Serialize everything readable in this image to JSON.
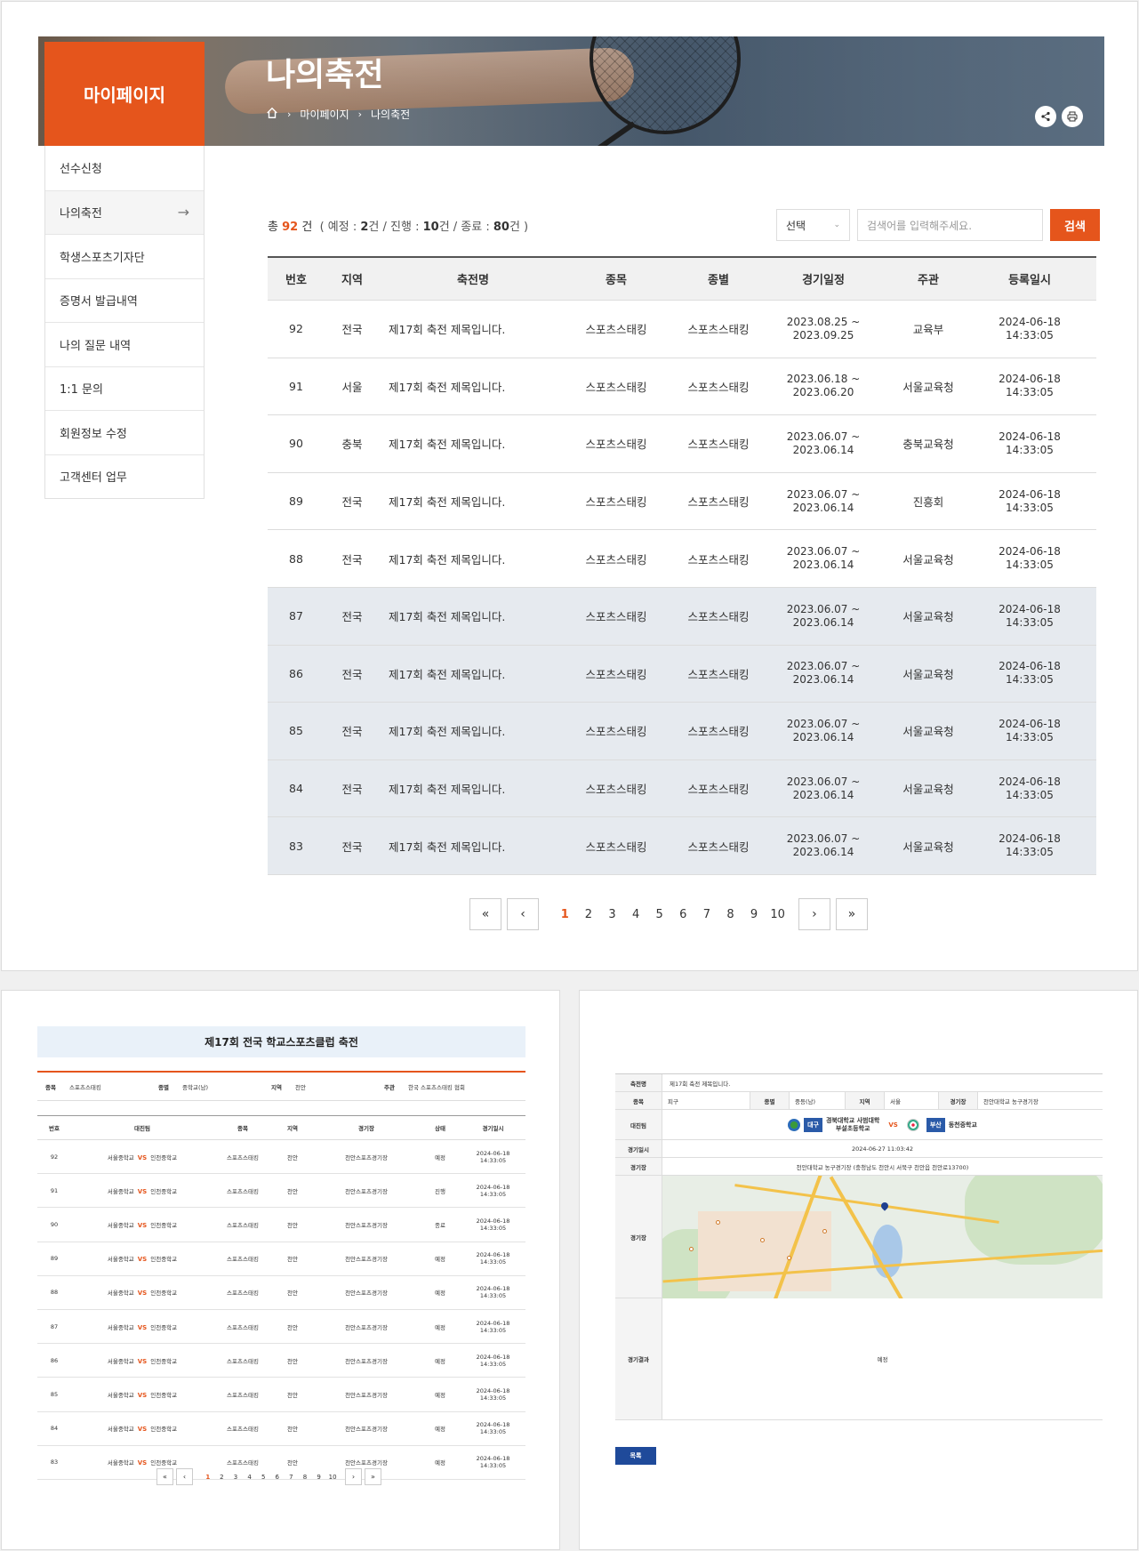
{
  "hero": {
    "title": "나의축전",
    "breadcrumb": [
      "마이페이지",
      "나의축전"
    ],
    "sidebar_title": "마이페이지"
  },
  "sidebar": {
    "items": [
      {
        "label": "선수신청"
      },
      {
        "label": "나의축전",
        "active": true
      },
      {
        "label": "학생스포츠기자단"
      },
      {
        "label": "증명서 발급내역"
      },
      {
        "label": "나의 질문 내역"
      },
      {
        "label": "1:1 문의"
      },
      {
        "label": "회원정보 수정"
      },
      {
        "label": "고객센터 업무"
      }
    ]
  },
  "summary": {
    "prefix": "총",
    "total": "92",
    "unit": "건",
    "detail_open": "( 예정 :",
    "scheduled": "2",
    "sep1": "건 / 진행 :",
    "ongoing": "10",
    "sep2": "건 / 종료 :",
    "ended": "80",
    "detail_close": "건 )"
  },
  "search": {
    "select_label": "선택",
    "placeholder": "검색어를 입력해주세요.",
    "button": "검색"
  },
  "table": {
    "headers": [
      "번호",
      "지역",
      "축전명",
      "종목",
      "종별",
      "경기일정",
      "주관",
      "등록일시"
    ],
    "rows": [
      {
        "no": "92",
        "region": "전국",
        "name": "제17회 축전 제목입니다.",
        "sport": "스포츠스태킹",
        "category": "스포츠스태킹",
        "date1": "2023.08.25 ~",
        "date2": "2023.09.25",
        "host": "교육부",
        "reg1": "2024-06-18",
        "reg2": "14:33:05"
      },
      {
        "no": "91",
        "region": "서울",
        "name": "제17회 축전 제목입니다.",
        "sport": "스포츠스태킹",
        "category": "스포츠스태킹",
        "date1": "2023.06.18 ~",
        "date2": "2023.06.20",
        "host": "서울교육청",
        "reg1": "2024-06-18",
        "reg2": "14:33:05"
      },
      {
        "no": "90",
        "region": "충북",
        "name": "제17회 축전 제목입니다.",
        "sport": "스포츠스태킹",
        "category": "스포츠스태킹",
        "date1": "2023.06.07 ~",
        "date2": "2023.06.14",
        "host": "충북교육청",
        "reg1": "2024-06-18",
        "reg2": "14:33:05"
      },
      {
        "no": "89",
        "region": "전국",
        "name": "제17회 축전 제목입니다.",
        "sport": "스포츠스태킹",
        "category": "스포츠스태킹",
        "date1": "2023.06.07 ~",
        "date2": "2023.06.14",
        "host": "진흥회",
        "reg1": "2024-06-18",
        "reg2": "14:33:05"
      },
      {
        "no": "88",
        "region": "전국",
        "name": "제17회 축전 제목입니다.",
        "sport": "스포츠스태킹",
        "category": "스포츠스태킹",
        "date1": "2023.06.07 ~",
        "date2": "2023.06.14",
        "host": "서울교육청",
        "reg1": "2024-06-18",
        "reg2": "14:33:05"
      },
      {
        "no": "87",
        "region": "전국",
        "name": "제17회 축전 제목입니다.",
        "sport": "스포츠스태킹",
        "category": "스포츠스태킹",
        "date1": "2023.06.07 ~",
        "date2": "2023.06.14",
        "host": "서울교육청",
        "reg1": "2024-06-18",
        "reg2": "14:33:05"
      },
      {
        "no": "86",
        "region": "전국",
        "name": "제17회 축전 제목입니다.",
        "sport": "스포츠스태킹",
        "category": "스포츠스태킹",
        "date1": "2023.06.07 ~",
        "date2": "2023.06.14",
        "host": "서울교육청",
        "reg1": "2024-06-18",
        "reg2": "14:33:05"
      },
      {
        "no": "85",
        "region": "전국",
        "name": "제17회 축전 제목입니다.",
        "sport": "스포츠스태킹",
        "category": "스포츠스태킹",
        "date1": "2023.06.07 ~",
        "date2": "2023.06.14",
        "host": "서울교육청",
        "reg1": "2024-06-18",
        "reg2": "14:33:05"
      },
      {
        "no": "84",
        "region": "전국",
        "name": "제17회 축전 제목입니다.",
        "sport": "스포츠스태킹",
        "category": "스포츠스태킹",
        "date1": "2023.06.07 ~",
        "date2": "2023.06.14",
        "host": "서울교육청",
        "reg1": "2024-06-18",
        "reg2": "14:33:05"
      },
      {
        "no": "83",
        "region": "전국",
        "name": "제17회 축전 제목입니다.",
        "sport": "스포츠스태킹",
        "category": "스포츠스태킹",
        "date1": "2023.06.07 ~",
        "date2": "2023.06.14",
        "host": "서울교육청",
        "reg1": "2024-06-18",
        "reg2": "14:33:05"
      }
    ]
  },
  "pagination": {
    "first": "«",
    "prev": "‹",
    "next": "›",
    "last": "»",
    "pages": [
      "1",
      "2",
      "3",
      "4",
      "5",
      "6",
      "7",
      "8",
      "9",
      "10"
    ],
    "current": "1"
  },
  "detail_list": {
    "title": "제17회 전국 학교스포츠클럽 축전",
    "info": [
      {
        "label": "종목",
        "value": "스포츠스태킹"
      },
      {
        "label": "종별",
        "value": "중학교(남)"
      },
      {
        "label": "지역",
        "value": "천안"
      },
      {
        "label": "주관",
        "value": "한국 스포츠스태킹 협회"
      }
    ],
    "headers": [
      "번호",
      "대진팀",
      "종목",
      "지역",
      "경기장",
      "상태",
      "경기일시"
    ],
    "vs": "VS",
    "rows": [
      {
        "no": "92",
        "team1": "서울중학교",
        "team2": "인천중학교",
        "sport": "스포츠스태킹",
        "region": "천안",
        "venue": "천안스포츠경기장",
        "status": "예정",
        "d1": "2024-06-18",
        "d2": "14:33:05"
      },
      {
        "no": "91",
        "team1": "서울중학교",
        "team2": "인천중학교",
        "sport": "스포츠스태킹",
        "region": "천안",
        "venue": "천안스포츠경기장",
        "status": "진행",
        "d1": "2024-06-18",
        "d2": "14:33:05"
      },
      {
        "no": "90",
        "team1": "서울중학교",
        "team2": "인천중학교",
        "sport": "스포츠스태킹",
        "region": "천안",
        "venue": "천안스포츠경기장",
        "status": "종료",
        "d1": "2024-06-18",
        "d2": "14:33:05"
      },
      {
        "no": "89",
        "team1": "서울중학교",
        "team2": "인천중학교",
        "sport": "스포츠스태킹",
        "region": "천안",
        "venue": "천안스포츠경기장",
        "status": "예정",
        "d1": "2024-06-18",
        "d2": "14:33:05"
      },
      {
        "no": "88",
        "team1": "서울중학교",
        "team2": "인천중학교",
        "sport": "스포츠스태킹",
        "region": "천안",
        "venue": "천안스포츠경기장",
        "status": "예정",
        "d1": "2024-06-18",
        "d2": "14:33:05"
      },
      {
        "no": "87",
        "team1": "서울중학교",
        "team2": "인천중학교",
        "sport": "스포츠스태킹",
        "region": "천안",
        "venue": "천안스포츠경기장",
        "status": "예정",
        "d1": "2024-06-18",
        "d2": "14:33:05"
      },
      {
        "no": "86",
        "team1": "서울중학교",
        "team2": "인천중학교",
        "sport": "스포츠스태킹",
        "region": "천안",
        "venue": "천안스포츠경기장",
        "status": "예정",
        "d1": "2024-06-18",
        "d2": "14:33:05"
      },
      {
        "no": "85",
        "team1": "서울중학교",
        "team2": "인천중학교",
        "sport": "스포츠스태킹",
        "region": "천안",
        "venue": "천안스포츠경기장",
        "status": "예정",
        "d1": "2024-06-18",
        "d2": "14:33:05"
      },
      {
        "no": "84",
        "team1": "서울중학교",
        "team2": "인천중학교",
        "sport": "스포츠스태킹",
        "region": "천안",
        "venue": "천안스포츠경기장",
        "status": "예정",
        "d1": "2024-06-18",
        "d2": "14:33:05"
      },
      {
        "no": "83",
        "team1": "서울중학교",
        "team2": "인천중학교",
        "sport": "스포츠스태킹",
        "region": "천안",
        "venue": "천안스포츠경기장",
        "status": "예정",
        "d1": "2024-06-18",
        "d2": "14:33:05"
      }
    ]
  },
  "match_detail": {
    "festival_label": "축전명",
    "festival_value": "제17회 축전 제목입니다.",
    "sport_label": "종목",
    "sport_value": "피구",
    "category_label": "종별",
    "category_value": "중등(남)",
    "region_label": "지역",
    "region_value": "서울",
    "venue_label": "경기장",
    "venue_value": "천안대학교 농구경기장",
    "teams_label": "대진팀",
    "team1_region": "대구",
    "team1_name_line1": "경북대학교 사범대학",
    "team1_name_line2": "부설초등학교",
    "vs": "VS",
    "team2_region": "부산",
    "team2_name": "동천중학교",
    "datetime_label": "경기일시",
    "datetime_value": "2024-06-27 11:03:42",
    "address_label": "경기장",
    "address_value": "천안대학교 농구경기장 (충청남도 천안시 서북구 천안읍 천안로13700)",
    "map_label": "경기장",
    "result_label": "경기결과",
    "result_value": "예정",
    "list_button": "목록"
  },
  "colors": {
    "accent": "#e5551c",
    "navy": "#1f4a9a",
    "row_highlight": "#e6eaef"
  }
}
